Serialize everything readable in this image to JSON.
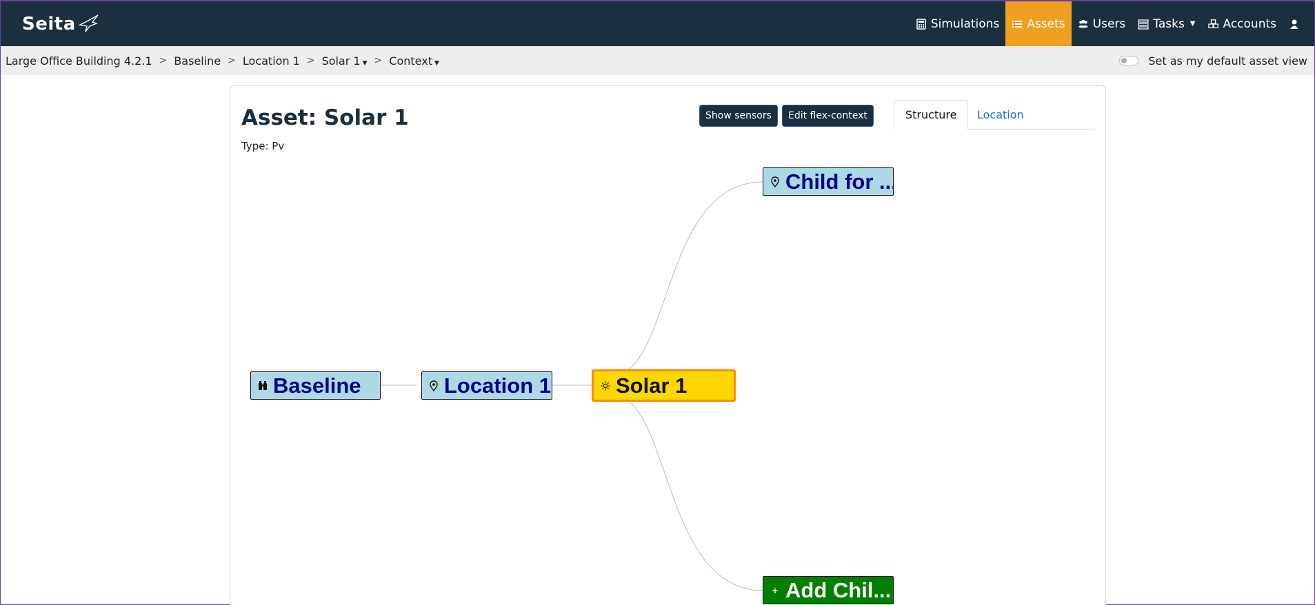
{
  "brand": {
    "name": "Seita"
  },
  "nav": {
    "items": [
      {
        "label": "Simulations",
        "icon": "calculator-icon",
        "active": false
      },
      {
        "label": "Assets",
        "icon": "list-icon",
        "active": true
      },
      {
        "label": "Users",
        "icon": "users-icon",
        "active": false
      },
      {
        "label": "Tasks",
        "icon": "tasks-icon",
        "active": false
      },
      {
        "label": "Accounts",
        "icon": "cubes-icon",
        "active": false
      }
    ],
    "user_icon": "user-icon"
  },
  "breadcrumb": {
    "items": [
      "Large Office Building 4.2.1",
      "Baseline",
      "Location 1",
      "Solar 1",
      "Context"
    ],
    "separator": ">",
    "default_view_label": "Set as my default asset view"
  },
  "asset": {
    "title": "Asset: Solar 1",
    "type": "Type: Pv"
  },
  "buttons": {
    "show_sensors": "Show sensors",
    "edit_flex_context": "Edit flex-context"
  },
  "tabs": {
    "structure": "Structure",
    "location": "Location"
  },
  "graph": {
    "nodes": {
      "baseline": {
        "label": "Baseline",
        "icon": "binoculars-icon"
      },
      "location": {
        "label": "Location 1",
        "icon": "map-marker-icon"
      },
      "solar": {
        "label": "Solar 1",
        "icon": "sun-icon"
      },
      "child": {
        "label": "Child for ...",
        "icon": "map-marker-icon"
      },
      "add_child": {
        "label": "Add Chil...",
        "icon": "plus-icon"
      }
    }
  },
  "colors": {
    "navbar": "#1b2f3f",
    "active_nav": "#f0a020",
    "node_blue": "#add8e6",
    "node_yellow": "#ffd700",
    "node_green": "#008000"
  }
}
